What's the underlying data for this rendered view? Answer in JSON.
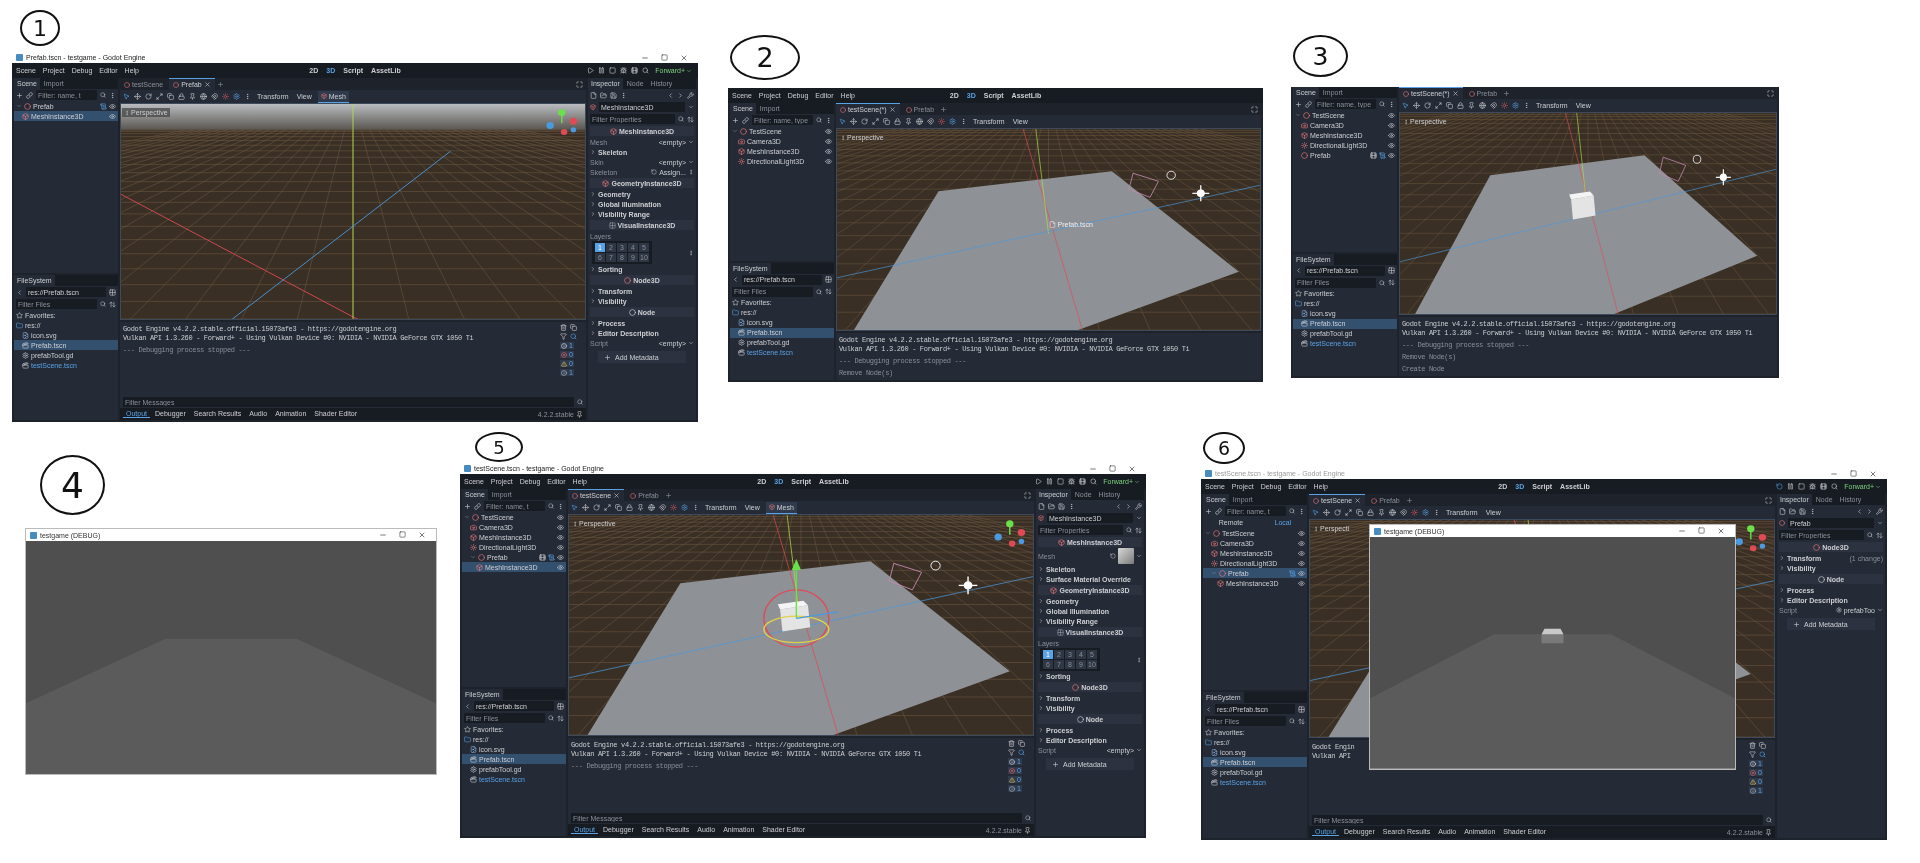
{
  "panels": [
    {
      "marker": "1",
      "kind": "editor",
      "title_bar": {
        "title": "Prefab.tscn - testgame - Godot Engine",
        "active": true
      },
      "menu": [
        "Scene",
        "Project",
        "Debug",
        "Editor",
        "Help"
      ],
      "workspaces": [
        {
          "label": "2D",
          "selected": false
        },
        {
          "label": "3D",
          "selected": true
        },
        {
          "label": "Script",
          "selected": false
        },
        {
          "label": "AssetLib",
          "selected": false
        }
      ],
      "run_controls": {
        "running": false,
        "renderer": "Forward+"
      },
      "scene_dock": {
        "tabs": [
          {
            "label": "Scene",
            "selected": true
          },
          {
            "label": "Import",
            "selected": false
          }
        ],
        "filter_placeholder": "Filter: name, t",
        "tree": [
          {
            "name": "Prefab",
            "kind": "node3d",
            "selected": false,
            "script": true,
            "instance": false,
            "children": [
              {
                "name": "MeshInstance3D",
                "kind": "mesh",
                "selected": true,
                "script": false,
                "instance": false
              }
            ]
          }
        ]
      },
      "filesystem": {
        "title": "FileSystem",
        "path": "res://Prefab.tscn",
        "filter_placeholder": "Filter Files",
        "items": [
          {
            "name": "Favorites:",
            "kind": "favorites",
            "selected": false,
            "highlighted": false
          },
          {
            "name": "res://",
            "kind": "folder",
            "selected": false,
            "highlighted": false,
            "children": [
              {
                "name": "icon.svg",
                "kind": "image",
                "selected": false,
                "highlighted": false
              },
              {
                "name": "Prefab.tscn",
                "kind": "scene",
                "selected": true,
                "highlighted": false
              },
              {
                "name": "prefabTool.gd",
                "kind": "script",
                "selected": false,
                "highlighted": false
              },
              {
                "name": "testScene.tscn",
                "kind": "scene",
                "selected": false,
                "highlighted": true
              }
            ]
          }
        ]
      },
      "scene_tabs": [
        {
          "label": "testScene",
          "selected": false
        },
        {
          "label": "Prefab",
          "selected": true
        }
      ],
      "toolbar_menus": [
        "Transform",
        "View"
      ],
      "mesh_menu": "Mesh",
      "viewport": {
        "label": "Perspective",
        "kind": "empty",
        "gizmo": true
      },
      "output": {
        "lines": [
          {
            "text": "Godot Engine v4.2.2.stable.official.15073afe3 - https://godotengine.org",
            "kind": "info"
          },
          {
            "text": "Vulkan API 1.3.260 - Forward+ - Using Vulkan Device #0: NVIDIA - NVIDIA GeForce GTX 1050 Ti",
            "kind": "info"
          },
          {
            "text": "--- Debugging process stopped ---",
            "kind": "dim"
          }
        ],
        "filter_placeholder": "Filter Messages",
        "counts": [
          "1",
          "0",
          "0",
          "1"
        ]
      },
      "bottom_tabs": [
        {
          "label": "Output",
          "selected": true
        },
        {
          "label": "Debugger",
          "selected": false
        },
        {
          "label": "Search Results",
          "selected": false
        },
        {
          "label": "Audio",
          "selected": false
        },
        {
          "label": "Animation",
          "selected": false
        },
        {
          "label": "Shader Editor",
          "selected": false
        }
      ],
      "version": "4.2.2.stable",
      "inspector": {
        "tabs": [
          {
            "label": "Inspector",
            "selected": true
          },
          {
            "label": "Node",
            "selected": false
          },
          {
            "label": "History",
            "selected": false
          }
        ],
        "node": {
          "name": "MeshInstance3D",
          "kind": "mesh"
        },
        "filter_placeholder": "Filter Properties",
        "rows": [
          {
            "kind": "mesh_class",
            "text": "MeshInstance3D"
          },
          {
            "kind": "prop",
            "label": "Mesh",
            "value": "<empty>"
          },
          {
            "kind": "section",
            "text": "Skeleton"
          },
          {
            "kind": "prop",
            "label": "Skin",
            "value": "<empty>"
          },
          {
            "kind": "assign",
            "label": "Skeleton",
            "value": "Assign..."
          },
          {
            "kind": "mesh_class",
            "text": "GeometryInstance3D"
          },
          {
            "kind": "section",
            "text": "Geometry"
          },
          {
            "kind": "section",
            "text": "Global Illumination"
          },
          {
            "kind": "section",
            "text": "Visibility Range"
          },
          {
            "kind": "visual_class",
            "text": "VisualInstance3D"
          },
          {
            "kind": "label",
            "text": "Layers"
          },
          {
            "kind": "layers",
            "cells": [
              {
                "label": "1",
                "on": true
              },
              {
                "label": "2",
                "on": false
              },
              {
                "label": "3",
                "on": false
              },
              {
                "label": "4",
                "on": false
              },
              {
                "label": "5",
                "on": false
              },
              {
                "label": "6",
                "on": false
              },
              {
                "label": "7",
                "on": false
              },
              {
                "label": "8",
                "on": false
              },
              {
                "label": "9",
                "on": false
              },
              {
                "label": "10",
                "on": false
              }
            ]
          },
          {
            "kind": "section",
            "text": "Sorting"
          },
          {
            "kind": "node3d_class",
            "text": "Node3D"
          },
          {
            "kind": "section",
            "text": "Transform"
          },
          {
            "kind": "section",
            "text": "Visibility"
          },
          {
            "kind": "node_class",
            "text": "Node"
          },
          {
            "kind": "section",
            "text": "Process"
          },
          {
            "kind": "section",
            "text": "Editor Description"
          },
          {
            "kind": "prop",
            "label": "Script",
            "value": "<empty>"
          },
          {
            "kind": "add",
            "text": "Add Metadata"
          }
        ]
      }
    },
    {
      "marker": "2",
      "kind": "editor",
      "menu": [
        "Scene",
        "Project",
        "Debug",
        "Editor",
        "Help"
      ],
      "workspaces": [
        {
          "label": "2D",
          "selected": false
        },
        {
          "label": "3D",
          "selected": true
        },
        {
          "label": "Script",
          "selected": false
        },
        {
          "label": "AssetLib",
          "selected": false
        }
      ],
      "scene_dock": {
        "tabs": [
          {
            "label": "Scene",
            "selected": true
          },
          {
            "label": "Import",
            "selected": false
          }
        ],
        "filter_placeholder": "Filter: name, type",
        "tree": [
          {
            "name": "TestScene",
            "kind": "node3d",
            "selected": false,
            "script": false,
            "instance": false,
            "children": [
              {
                "name": "Camera3D",
                "kind": "camera",
                "selected": false,
                "script": false,
                "instance": false
              },
              {
                "name": "MeshInstance3D",
                "kind": "mesh",
                "selected": false,
                "script": false,
                "instance": false
              },
              {
                "name": "DirectionalLight3D",
                "kind": "light",
                "selected": false,
                "script": false,
                "instance": false
              }
            ]
          }
        ]
      },
      "filesystem": {
        "title": "FileSystem",
        "path": "res://Prefab.tscn",
        "filter_placeholder": "Filter Files",
        "items": [
          {
            "name": "Favorites:",
            "kind": "favorites",
            "selected": false,
            "highlighted": false
          },
          {
            "name": "res://",
            "kind": "folder",
            "selected": false,
            "highlighted": false,
            "children": [
              {
                "name": "icon.svg",
                "kind": "image",
                "selected": false,
                "highlighted": false
              },
              {
                "name": "Prefab.tscn",
                "kind": "scene",
                "selected": true,
                "highlighted": false
              },
              {
                "name": "prefabTool.gd",
                "kind": "script",
                "selected": false,
                "highlighted": false
              },
              {
                "name": "testScene.tscn",
                "kind": "scene",
                "selected": false,
                "highlighted": true
              }
            ]
          }
        ]
      },
      "scene_tabs": [
        {
          "label": "testScene(*)",
          "selected": true
        },
        {
          "label": "Prefab",
          "selected": false
        }
      ],
      "toolbar_menus": [
        "Transform",
        "View"
      ],
      "viewport": {
        "label": "Perspective",
        "kind": "plane",
        "gizmo": false,
        "drop_label": "Prefab.tscn"
      },
      "output": {
        "lines": [
          {
            "text": "Godot Engine v4.2.2.stable.official.15073afe3 - https://godotengine.org",
            "kind": "info"
          },
          {
            "text": "Vulkan API 1.3.260 - Forward+ - Using Vulkan Device #0: NVIDIA - NVIDIA GeForce GTX 1050 Ti",
            "kind": "info"
          },
          {
            "text": "--- Debugging process stopped ---",
            "kind": "dim"
          },
          {
            "text": "Remove Node(s)",
            "kind": "dim"
          }
        ]
      }
    },
    {
      "marker": "3",
      "kind": "editor",
      "scene_dock": {
        "tabs": [
          {
            "label": "Scene",
            "selected": true
          },
          {
            "label": "Import",
            "selected": false
          }
        ],
        "filter_placeholder": "Filter: name, type",
        "tree": [
          {
            "name": "TestScene",
            "kind": "node3d",
            "selected": false,
            "script": false,
            "instance": false,
            "children": [
              {
                "name": "Camera3D",
                "kind": "camera",
                "selected": false,
                "script": false,
                "instance": false
              },
              {
                "name": "MeshInstance3D",
                "kind": "mesh",
                "selected": false,
                "script": false,
                "instance": false
              },
              {
                "name": "DirectionalLight3D",
                "kind": "light",
                "selected": false,
                "script": false,
                "instance": false
              },
              {
                "name": "Prefab",
                "kind": "node3d",
                "selected": false,
                "script": true,
                "instance": true
              }
            ]
          }
        ]
      },
      "filesystem": {
        "title": "FileSystem",
        "path": "res://Prefab.tscn",
        "filter_placeholder": "Filter Files",
        "items": [
          {
            "name": "Favorites:",
            "kind": "favorites",
            "selected": false,
            "highlighted": false
          },
          {
            "name": "res://",
            "kind": "folder",
            "selected": false,
            "highlighted": false,
            "children": [
              {
                "name": "icon.svg",
                "kind": "image",
                "selected": false,
                "highlighted": false
              },
              {
                "name": "Prefab.tscn",
                "kind": "scene",
                "selected": true,
                "highlighted": false
              },
              {
                "name": "prefabTool.gd",
                "kind": "script",
                "selected": false,
                "highlighted": false
              },
              {
                "name": "testScene.tscn",
                "kind": "scene",
                "selected": false,
                "highlighted": true
              }
            ]
          }
        ]
      },
      "scene_tabs": [
        {
          "label": "testScene(*)",
          "selected": true
        },
        {
          "label": "Prefab",
          "selected": false
        }
      ],
      "toolbar_menus": [
        "Transform",
        "View"
      ],
      "viewport": {
        "label": "Perspective",
        "kind": "plane_cube",
        "gizmo": false
      },
      "output": {
        "lines": [
          {
            "text": "Godot Engine v4.2.2.stable.official.15073afe3 - https://godotengine.org",
            "kind": "info"
          },
          {
            "text": "Vulkan API 1.3.260 - Forward+ - Using Vulkan Device #0: NVIDIA - NVIDIA GeForce GTX 1050 Ti",
            "kind": "info"
          },
          {
            "text": "--- Debugging process stopped ---",
            "kind": "dim"
          },
          {
            "text": "Remove Node(s)",
            "kind": "dim"
          },
          {
            "text": "Create Node",
            "kind": "dim"
          }
        ]
      }
    },
    {
      "marker": "4",
      "kind": "game",
      "game_window": {
        "title": "testgame (DEBUG)",
        "kind": "floor"
      }
    },
    {
      "marker": "5",
      "kind": "editor",
      "title_bar": {
        "title": "testScene.tscn - testgame - Godot Engine",
        "active": true
      },
      "menu": [
        "Scene",
        "Project",
        "Debug",
        "Editor",
        "Help"
      ],
      "workspaces": [
        {
          "label": "2D",
          "selected": false
        },
        {
          "label": "3D",
          "selected": true
        },
        {
          "label": "Script",
          "selected": false
        },
        {
          "label": "AssetLib",
          "selected": false
        }
      ],
      "run_controls": {
        "running": false,
        "renderer": "Forward+"
      },
      "scene_dock": {
        "tabs": [
          {
            "label": "Scene",
            "selected": true
          },
          {
            "label": "Import",
            "selected": false
          }
        ],
        "filter_placeholder": "Filter: name, t",
        "tree": [
          {
            "name": "TestScene",
            "kind": "node3d",
            "selected": false,
            "script": false,
            "instance": false,
            "children": [
              {
                "name": "Camera3D",
                "kind": "camera",
                "selected": false,
                "script": false,
                "instance": false
              },
              {
                "name": "MeshInstance3D",
                "kind": "mesh",
                "selected": false,
                "script": false,
                "instance": false
              },
              {
                "name": "DirectionalLight3D",
                "kind": "light",
                "selected": false,
                "script": false,
                "instance": false
              },
              {
                "name": "Prefab",
                "kind": "node3d",
                "selected": false,
                "script": true,
                "instance": true,
                "children": [
                  {
                    "name": "MeshInstance3D",
                    "kind": "mesh",
                    "selected": true,
                    "script": false,
                    "instance": false
                  }
                ]
              }
            ]
          }
        ]
      },
      "filesystem": {
        "title": "FileSystem",
        "path": "res://Prefab.tscn",
        "filter_placeholder": "Filter Files",
        "items": [
          {
            "name": "Favorites:",
            "kind": "favorites",
            "selected": false,
            "highlighted": false
          },
          {
            "name": "res://",
            "kind": "folder",
            "selected": false,
            "highlighted": false,
            "children": [
              {
                "name": "icon.svg",
                "kind": "image",
                "selected": false,
                "highlighted": false
              },
              {
                "name": "Prefab.tscn",
                "kind": "scene",
                "selected": true,
                "highlighted": false
              },
              {
                "name": "prefabTool.gd",
                "kind": "script",
                "selected": false,
                "highlighted": false
              },
              {
                "name": "testScene.tscn",
                "kind": "scene",
                "selected": false,
                "highlighted": true
              }
            ]
          }
        ]
      },
      "scene_tabs": [
        {
          "label": "testScene",
          "selected": true
        },
        {
          "label": "Prefab",
          "selected": false
        }
      ],
      "toolbar_menus": [
        "Transform",
        "View"
      ],
      "mesh_menu": "Mesh",
      "viewport": {
        "label": "Perspective",
        "kind": "plane_gizmo",
        "gizmo": true
      },
      "output": {
        "lines": [
          {
            "text": "Godot Engine v4.2.2.stable.official.15073afe3 - https://godotengine.org",
            "kind": "info"
          },
          {
            "text": "Vulkan API 1.3.260 - Forward+ - Using Vulkan Device #0: NVIDIA - NVIDIA GeForce GTX 1050 Ti",
            "kind": "info"
          },
          {
            "text": "--- Debugging process stopped ---",
            "kind": "dim"
          }
        ],
        "filter_placeholder": "Filter Messages",
        "counts": [
          "1",
          "0",
          "0",
          "1"
        ]
      },
      "bottom_tabs": [
        {
          "label": "Output",
          "selected": true
        },
        {
          "label": "Debugger",
          "selected": false
        },
        {
          "label": "Search Results",
          "selected": false
        },
        {
          "label": "Audio",
          "selected": false
        },
        {
          "label": "Animation",
          "selected": false
        },
        {
          "label": "Shader Editor",
          "selected": false
        }
      ],
      "version": "4.2.2.stable",
      "inspector": {
        "tabs": [
          {
            "label": "Inspector",
            "selected": true
          },
          {
            "label": "Node",
            "selected": false
          },
          {
            "label": "History",
            "selected": false
          }
        ],
        "node": {
          "name": "MeshInstance3D",
          "kind": "mesh"
        },
        "filter_placeholder": "Filter Properties",
        "rows": [
          {
            "kind": "mesh_class",
            "text": "MeshInstance3D"
          },
          {
            "kind": "mesh",
            "label": "Mesh"
          },
          {
            "kind": "section",
            "text": "Skeleton"
          },
          {
            "kind": "section",
            "text": "Surface Material Override"
          },
          {
            "kind": "mesh_class",
            "text": "GeometryInstance3D"
          },
          {
            "kind": "section",
            "text": "Geometry"
          },
          {
            "kind": "section",
            "text": "Global Illumination"
          },
          {
            "kind": "section",
            "text": "Visibility Range"
          },
          {
            "kind": "visual_class",
            "text": "VisualInstance3D"
          },
          {
            "kind": "label",
            "text": "Layers"
          },
          {
            "kind": "layers",
            "cells": [
              {
                "label": "1",
                "on": true
              },
              {
                "label": "2",
                "on": false
              },
              {
                "label": "3",
                "on": false
              },
              {
                "label": "4",
                "on": false
              },
              {
                "label": "5",
                "on": false
              },
              {
                "label": "6",
                "on": false
              },
              {
                "label": "7",
                "on": false
              },
              {
                "label": "8",
                "on": false
              },
              {
                "label": "9",
                "on": false
              },
              {
                "label": "10",
                "on": false
              }
            ]
          },
          {
            "kind": "section",
            "text": "Sorting"
          },
          {
            "kind": "node3d_class",
            "text": "Node3D"
          },
          {
            "kind": "section",
            "text": "Transform"
          },
          {
            "kind": "section",
            "text": "Visibility"
          },
          {
            "kind": "node_class",
            "text": "Node"
          },
          {
            "kind": "section",
            "text": "Process"
          },
          {
            "kind": "section",
            "text": "Editor Description"
          },
          {
            "kind": "prop",
            "label": "Script",
            "value": "<empty>"
          },
          {
            "kind": "add",
            "text": "Add Metadata"
          }
        ]
      }
    },
    {
      "marker": "6",
      "kind": "editor",
      "title_bar": {
        "title": "testScene.tscn - testgame - Godot Engine",
        "active": false
      },
      "menu": [
        "Scene",
        "Project",
        "Debug",
        "Editor",
        "Help"
      ],
      "workspaces": [
        {
          "label": "2D",
          "selected": false
        },
        {
          "label": "3D",
          "selected": true
        },
        {
          "label": "Script",
          "selected": false
        },
        {
          "label": "AssetLib",
          "selected": false
        }
      ],
      "run_controls": {
        "running": true,
        "renderer": "Forward+"
      },
      "scene_dock": {
        "tabs": [
          {
            "label": "Scene",
            "selected": true
          },
          {
            "label": "Import",
            "selected": false
          }
        ],
        "filter_placeholder": "Filter: name, t",
        "remote_local": [
          {
            "label": "Remote",
            "selected": false
          },
          {
            "label": "Local",
            "selected": true
          }
        ],
        "tree": [
          {
            "name": "TestScene",
            "kind": "node3d",
            "selected": false,
            "script": false,
            "instance": false,
            "children": [
              {
                "name": "Camera3D",
                "kind": "camera",
                "selected": false,
                "script": false,
                "instance": false
              },
              {
                "name": "MeshInstance3D",
                "kind": "mesh",
                "selected": false,
                "script": false,
                "instance": false
              },
              {
                "name": "DirectionalLight3D",
                "kind": "light",
                "selected": false,
                "script": false,
                "instance": false
              },
              {
                "name": "Prefab",
                "kind": "node3d",
                "selected": true,
                "script": true,
                "instance": false,
                "children": [
                  {
                    "name": "MeshInstance3D",
                    "kind": "mesh",
                    "selected": false,
                    "script": false,
                    "instance": false
                  }
                ]
              }
            ]
          }
        ]
      },
      "filesystem": {
        "title": "FileSystem",
        "path": "res://Prefab.tscn",
        "filter_placeholder": "Filter Files",
        "items": [
          {
            "name": "Favorites:",
            "kind": "favorites",
            "selected": false,
            "highlighted": false
          },
          {
            "name": "res://",
            "kind": "folder",
            "selected": false,
            "highlighted": false,
            "children": [
              {
                "name": "icon.svg",
                "kind": "image",
                "selected": false,
                "highlighted": false
              },
              {
                "name": "Prefab.tscn",
                "kind": "scene",
                "selected": true,
                "highlighted": false
              },
              {
                "name": "prefabTool.gd",
                "kind": "script",
                "selected": false,
                "highlighted": false
              },
              {
                "name": "testScene.tscn",
                "kind": "scene",
                "selected": false,
                "highlighted": true
              }
            ]
          }
        ]
      },
      "scene_tabs": [
        {
          "label": "testScene",
          "selected": true
        },
        {
          "label": "Prefab",
          "selected": false
        }
      ],
      "toolbar_menus": [
        "Transform",
        "View"
      ],
      "viewport": {
        "label": "Perspecti",
        "kind": "plane_cube",
        "gizmo": true
      },
      "game_window": {
        "title": "testgame (DEBUG)",
        "kind": "floor_cube"
      },
      "output": {
        "lines": [
          {
            "text": "Godot Engin",
            "kind": "info"
          },
          {
            "text": "Vulkan API",
            "kind": "info"
          }
        ],
        "filter_placeholder": "Filter Messages",
        "counts": [
          "1",
          "0",
          "0",
          "1"
        ]
      },
      "bottom_tabs": [
        {
          "label": "Output",
          "selected": true
        },
        {
          "label": "Debugger",
          "selected": false
        },
        {
          "label": "Search Results",
          "selected": false
        },
        {
          "label": "Audio",
          "selected": false
        },
        {
          "label": "Animation",
          "selected": false
        },
        {
          "label": "Shader Editor",
          "selected": false
        }
      ],
      "version": "4.2.2.stable",
      "inspector": {
        "tabs": [
          {
            "label": "Inspector",
            "selected": true
          },
          {
            "label": "Node",
            "selected": false
          },
          {
            "label": "History",
            "selected": false
          }
        ],
        "node": {
          "name": "Prefab",
          "kind": "node3d"
        },
        "filter_placeholder": "Filter Properties",
        "rows": [
          {
            "kind": "node3d_class",
            "text": "Node3D"
          },
          {
            "kind": "section",
            "text": "Transform",
            "note": "(1 change)"
          },
          {
            "kind": "section",
            "text": "Visibility"
          },
          {
            "kind": "node_class",
            "text": "Node"
          },
          {
            "kind": "section",
            "text": "Process"
          },
          {
            "kind": "section",
            "text": "Editor Description"
          },
          {
            "kind": "resource",
            "label": "Script",
            "value": "prefabToo"
          },
          {
            "kind": "add",
            "text": "Add Metadata"
          }
        ]
      }
    }
  ]
}
